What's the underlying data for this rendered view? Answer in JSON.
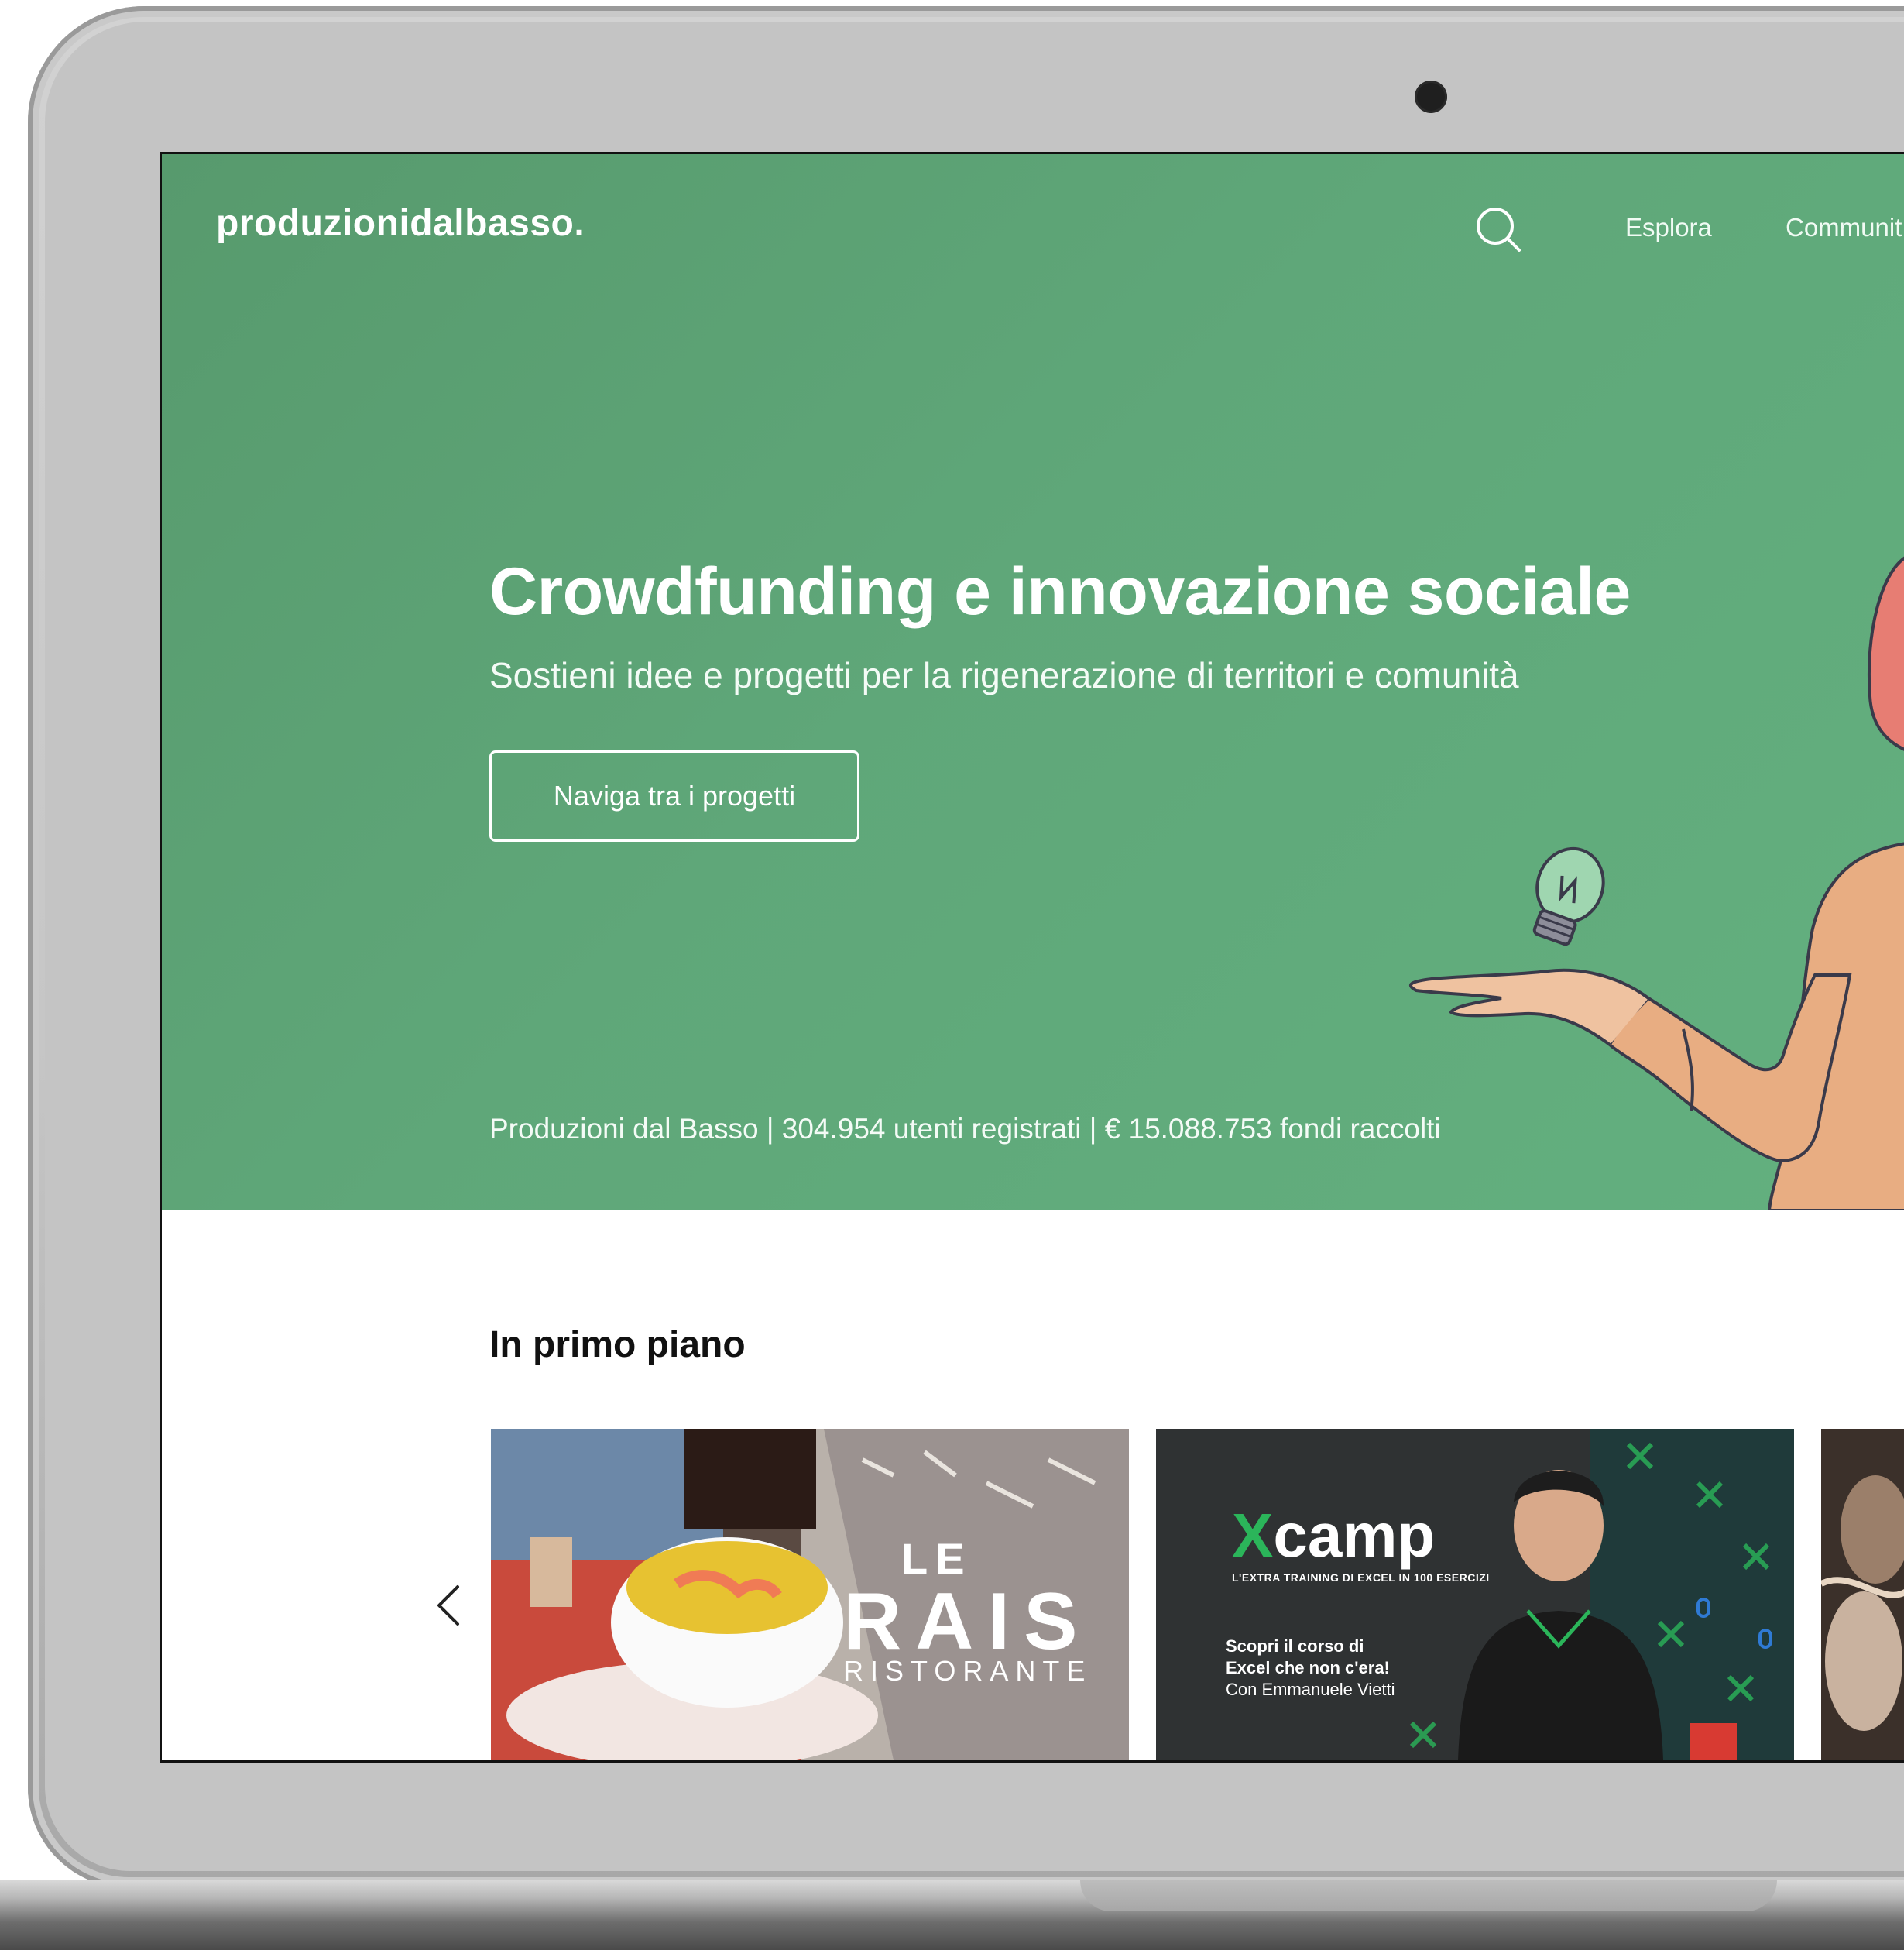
{
  "site": {
    "logo_text": "produzionidalbasso."
  },
  "nav": {
    "search_icon": "search-icon",
    "links": [
      "Esplora",
      "Communit"
    ]
  },
  "hero": {
    "title": "Crowdfunding e innovazione sociale",
    "subtitle": "Sostieni idee e progetti per la rigenerazione di territori e comunità",
    "cta_label": "Naviga tra i progetti",
    "stats": "Produzioni dal Basso | 304.954 utenti registrati | € 15.088.753 fondi raccolti"
  },
  "featured": {
    "title": "In primo piano",
    "prev_icon": "chevron-left-icon",
    "cards": [
      {
        "line1": "LE",
        "line2": "RAIS",
        "line3": "RISTORANTE"
      },
      {
        "logo_x": "X",
        "logo_word": "camp",
        "tagline": "L'EXTRA TRAINING DI EXCEL IN 100 ESERCIZI",
        "line1": "Scopri il corso di",
        "line2": "Excel che non c'era!",
        "line3": "Con Emmanuele Vietti"
      }
    ]
  },
  "colors": {
    "hero_green": "#5fa779",
    "white": "#ffffff",
    "xcamp_green": "#2bb55a"
  }
}
